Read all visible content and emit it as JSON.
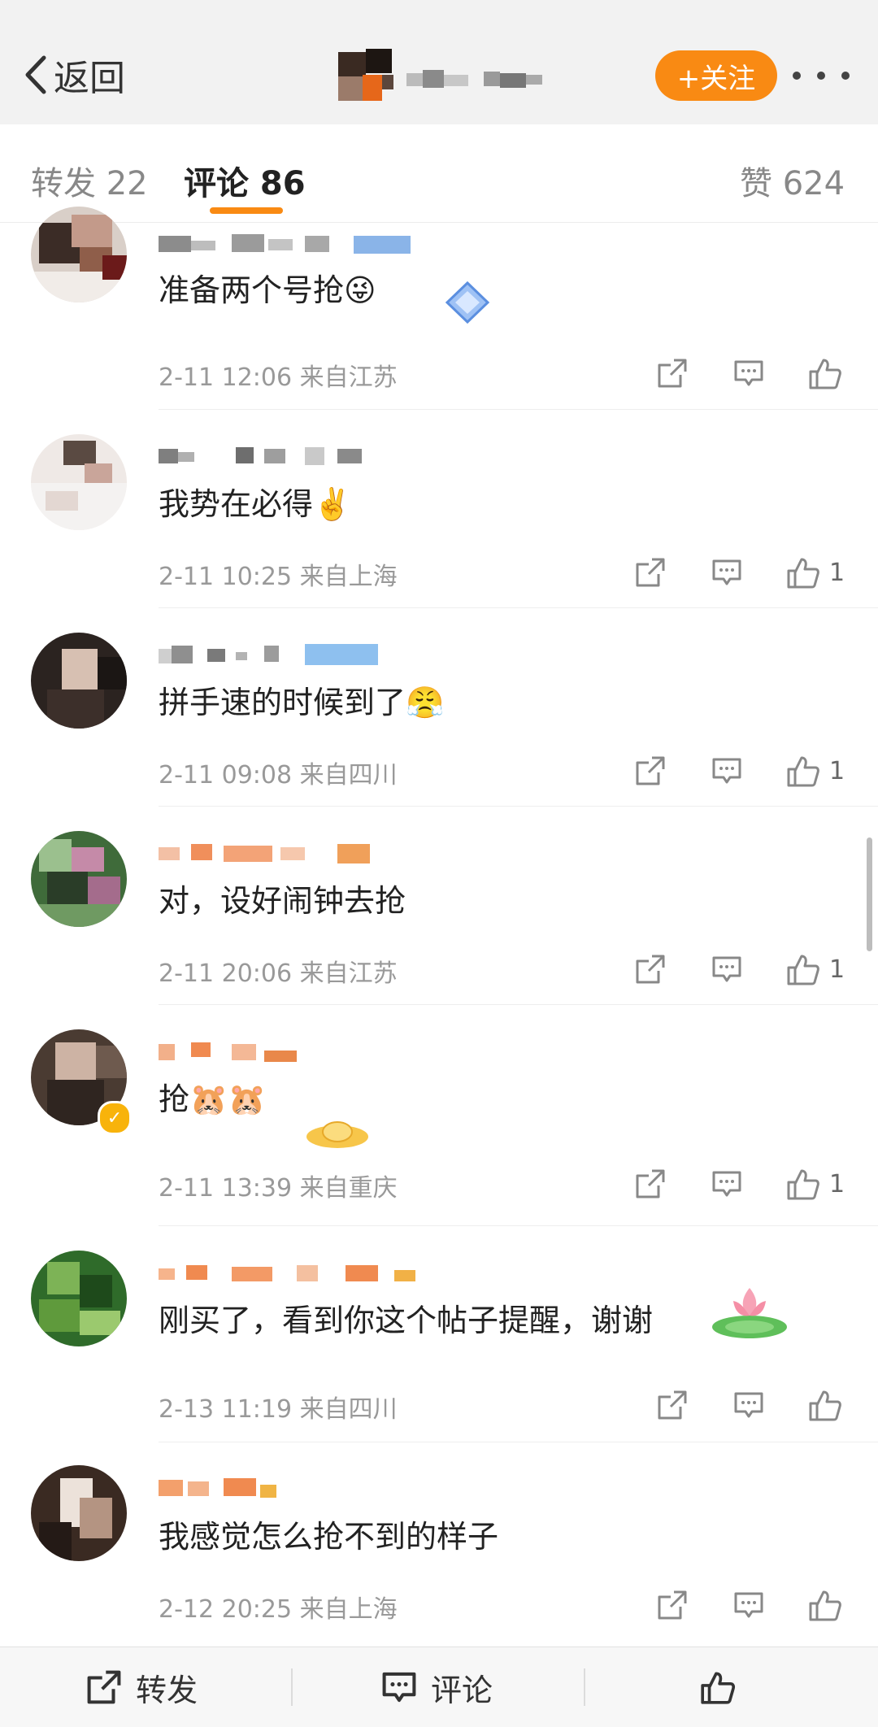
{
  "header": {
    "back_label": "返回",
    "follow_label": "+关注"
  },
  "tabs": {
    "repost": "转发 22",
    "comments": "评论 86",
    "likes": "赞 624"
  },
  "comments": [
    {
      "text": "准备两个号抢",
      "emoji": "😜",
      "meta": "2-11 12:06  来自江苏",
      "likes": ""
    },
    {
      "text": "我势在必得",
      "emoji": "✌️",
      "meta": "2-11 10:25  来自上海",
      "likes": "1"
    },
    {
      "text": "拼手速的时候到了",
      "emoji": "😤",
      "meta": "2-11 09:08  来自四川",
      "likes": "1"
    },
    {
      "text": "对，设好闹钟去抢",
      "emoji": "",
      "meta": "2-11 20:06  来自江苏",
      "likes": "1"
    },
    {
      "text": "抢",
      "emoji": "🐹🐹",
      "meta": "2-11 13:39  来自重庆",
      "likes": "1"
    },
    {
      "text": "刚买了，看到你这个帖子提醒，谢谢",
      "emoji": "",
      "meta": "2-13 11:19  来自四川",
      "likes": ""
    },
    {
      "text": "我感觉怎么抢不到的样子",
      "emoji": "",
      "meta": "2-12 20:25  来自上海",
      "likes": ""
    }
  ],
  "bottom_bar": {
    "repost_label": "转发",
    "comment_label": "评论"
  },
  "colors": {
    "accent": "#f98a13",
    "verified_badge": "#f8b30b"
  },
  "icons": [
    "chevron-left-icon",
    "more-icon",
    "share-icon",
    "comment-icon",
    "like-icon"
  ]
}
